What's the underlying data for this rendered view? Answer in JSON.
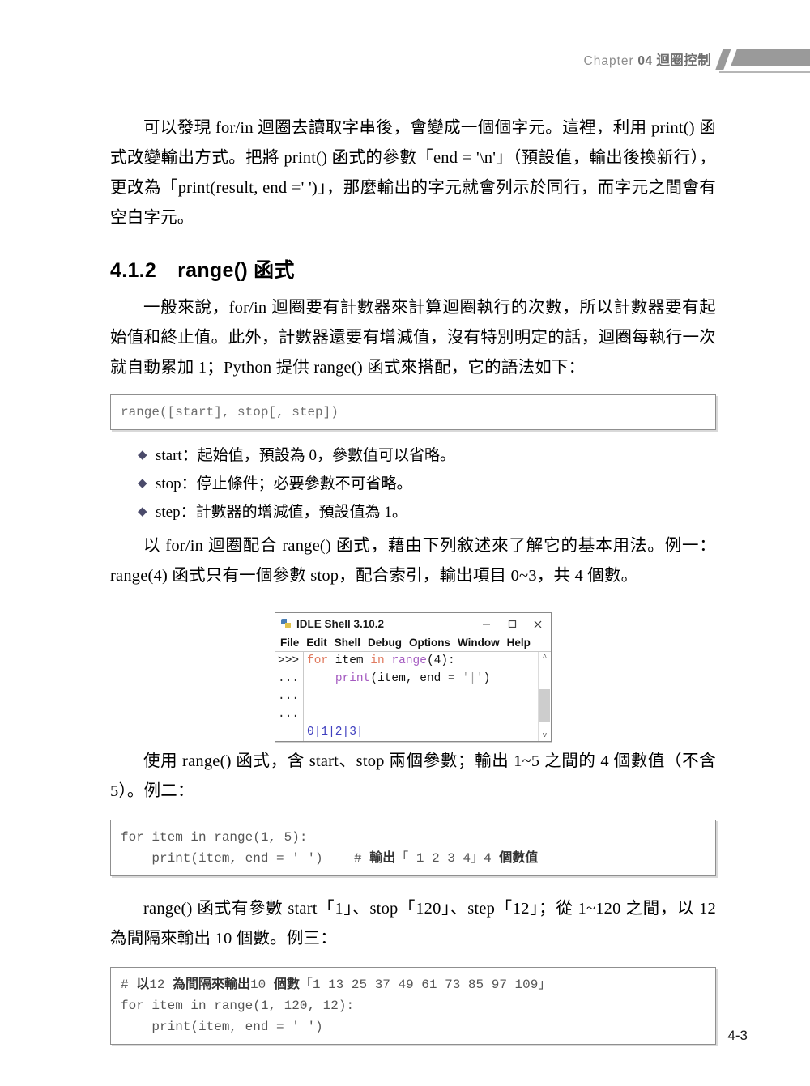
{
  "header": {
    "chapter_word": "Chapter",
    "chapter_number": "04",
    "chapter_title": "迴圈控制"
  },
  "content": {
    "paragraph_1": "可以發現 for/in 迴圈去讀取字串後，會變成一個個字元。這裡，利用 print() 函式改變輸出方式。把將 print() 函式的參數「end = '\\n'」（預設值，輸出後換新行），更改為「print(result, end =' ')」，那麼輸出的字元就會列示於同行，而字元之間會有空白字元。",
    "section_number": "4.1.2",
    "section_title": "range() 函式",
    "paragraph_2": "一般來說，for/in 迴圈要有計數器來計算迴圈執行的次數，所以計數器要有起始值和終止值。此外，計數器還要有增減值，沒有特別明定的話，迴圈每執行一次就自動累加 1；Python 提供 range() 函式來搭配，它的語法如下：",
    "syntax_box": "range([start], stop[, step])",
    "params": [
      "start：起始值，預設為 0，參數值可以省略。",
      "stop：停止條件；必要參數不可省略。",
      "step：計數器的增減值，預設值為 1。"
    ],
    "paragraph_3": "以 for/in 迴圈配合 range() 函式，藉由下列敘述來了解它的基本用法。例一：range(4) 函式只有一個參數 stop，配合索引，輸出項目 0~3，共 4 個數。",
    "paragraph_4": "使用 range() 函式，含 start、stop 兩個參數；輸出 1~5 之間的 4 個數值（不含 5）。例二：",
    "paragraph_5": "range() 函式有參數 start「1」、stop「120」、step「12」；從 1~120 之間，以 12 為間隔來輸出 10 個數。例三："
  },
  "idle_window": {
    "title": "IDLE Shell 3.10.2",
    "icon": "idle-app-icon",
    "window_buttons": {
      "minimize": "minimize-button",
      "maximize": "maximize-button",
      "close": "close-button"
    },
    "menu_items": [
      "File",
      "Edit",
      "Shell",
      "Debug",
      "Options",
      "Window",
      "Help"
    ],
    "prompts": [
      ">>>",
      "...",
      "...",
      "..."
    ],
    "code_lines": [
      {
        "tokens": [
          {
            "text": "for",
            "type": "keyword"
          },
          {
            "text": " item ",
            "type": "default"
          },
          {
            "text": "in",
            "type": "keyword"
          },
          {
            "text": " ",
            "type": "default"
          },
          {
            "text": "range",
            "type": "builtin"
          },
          {
            "text": "(4):",
            "type": "default"
          }
        ]
      },
      {
        "tokens": [
          {
            "text": "    ",
            "type": "default"
          },
          {
            "text": "print",
            "type": "builtin"
          },
          {
            "text": "(item, end = ",
            "type": "default"
          },
          {
            "text": "'|'",
            "type": "string"
          },
          {
            "text": ")",
            "type": "default"
          }
        ]
      },
      {
        "tokens": []
      },
      {
        "tokens": []
      }
    ],
    "output_line": "0|1|2|3|",
    "scrollbar": {
      "up_arrow": "^",
      "down_arrow": "v"
    }
  },
  "code_block_2": {
    "line_1": "for item in range(1, 5):",
    "line_2_code": "    print(item, end = ' ')    # ",
    "line_2_comment": "輸出",
    "line_2_rest": "「 1 2 3 4」4 ",
    "line_2_tail": "個數值"
  },
  "code_block_3": {
    "line_1_hash": "# ",
    "line_1_cjk_a": "以",
    "line_1_num_a": "12 ",
    "line_1_cjk_b": "為間隔來輸出",
    "line_1_num_b": "10 ",
    "line_1_cjk_c": "個數",
    "line_1_nums": "「1 13 25 37 49 61 73 85 97 109」",
    "line_2": "for item in range(1, 120, 12):",
    "line_3": "    print(item, end = ' ')"
  },
  "footer": {
    "page_number": "4-3"
  },
  "colors": {
    "header_gray": "#9a9a9a",
    "keyword": "#e07a5f",
    "builtin": "#a45ac0",
    "string": "#a0a0a0",
    "output": "#3f3fbf",
    "code_border": "#8f8f8f"
  }
}
